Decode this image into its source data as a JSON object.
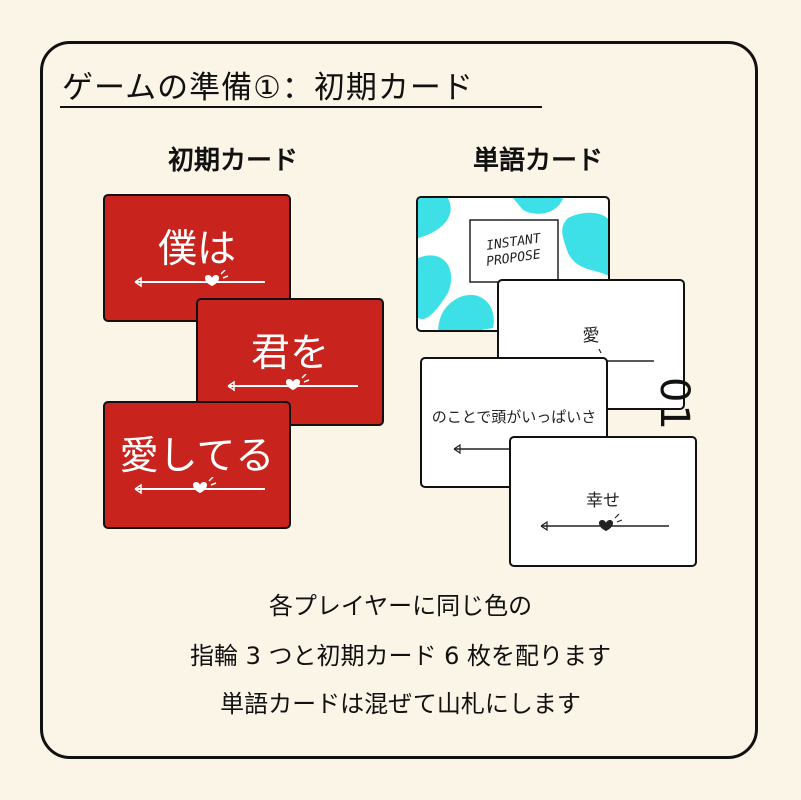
{
  "heading": "ゲームの準備①：初期カード",
  "left_label": "初期カード",
  "right_label": "単語カード",
  "initial_cards": [
    "僕は",
    "君を",
    "愛してる"
  ],
  "card_back_logo": "INSTANT PROPOSE",
  "word_cards": [
    "愛",
    "のことで頭がいっぱいさ",
    "幸せ"
  ],
  "step_number": "01",
  "instructions": [
    "各プレイヤーに同じ色の",
    "指輪 3 つと初期カード 6 枚を配ります",
    "単語カードは混ぜて山札にします"
  ],
  "colors": {
    "card_red": "#c8231d",
    "card_back_cyan": "#3ee0e8",
    "background": "#fbf5e7"
  }
}
